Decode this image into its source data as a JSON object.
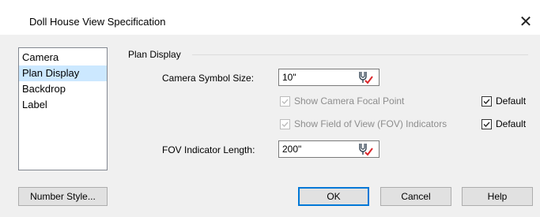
{
  "window": {
    "title": "Doll House View Specification",
    "close_glyph": "✕"
  },
  "sidebar": {
    "items": [
      {
        "label": "Camera",
        "selected": false
      },
      {
        "label": "Plan Display",
        "selected": true
      },
      {
        "label": "Backdrop",
        "selected": false
      },
      {
        "label": "Label",
        "selected": false
      }
    ]
  },
  "panel": {
    "group_title": "Plan Display",
    "camera_symbol_size": {
      "label": "Camera Symbol Size:",
      "value": "10\"",
      "icon": "unit-picker-icon"
    },
    "show_focal_point": {
      "label": "Show Camera Focal Point",
      "checked": true,
      "enabled": false,
      "default_label": "Default",
      "default_checked": true
    },
    "show_fov_indicators": {
      "label": "Show Field of View (FOV) Indicators",
      "checked": true,
      "enabled": false,
      "default_label": "Default",
      "default_checked": true
    },
    "fov_indicator_length": {
      "label": "FOV Indicator Length:",
      "value": "200\"",
      "icon": "unit-picker-icon"
    }
  },
  "footer": {
    "number_style": "Number Style...",
    "ok": "OK",
    "cancel": "Cancel",
    "help": "Help"
  },
  "colors": {
    "selection": "#cce8ff",
    "accent": "#0078d7",
    "icon_red": "#d9262a",
    "disabled_text": "#8d8d8d"
  }
}
